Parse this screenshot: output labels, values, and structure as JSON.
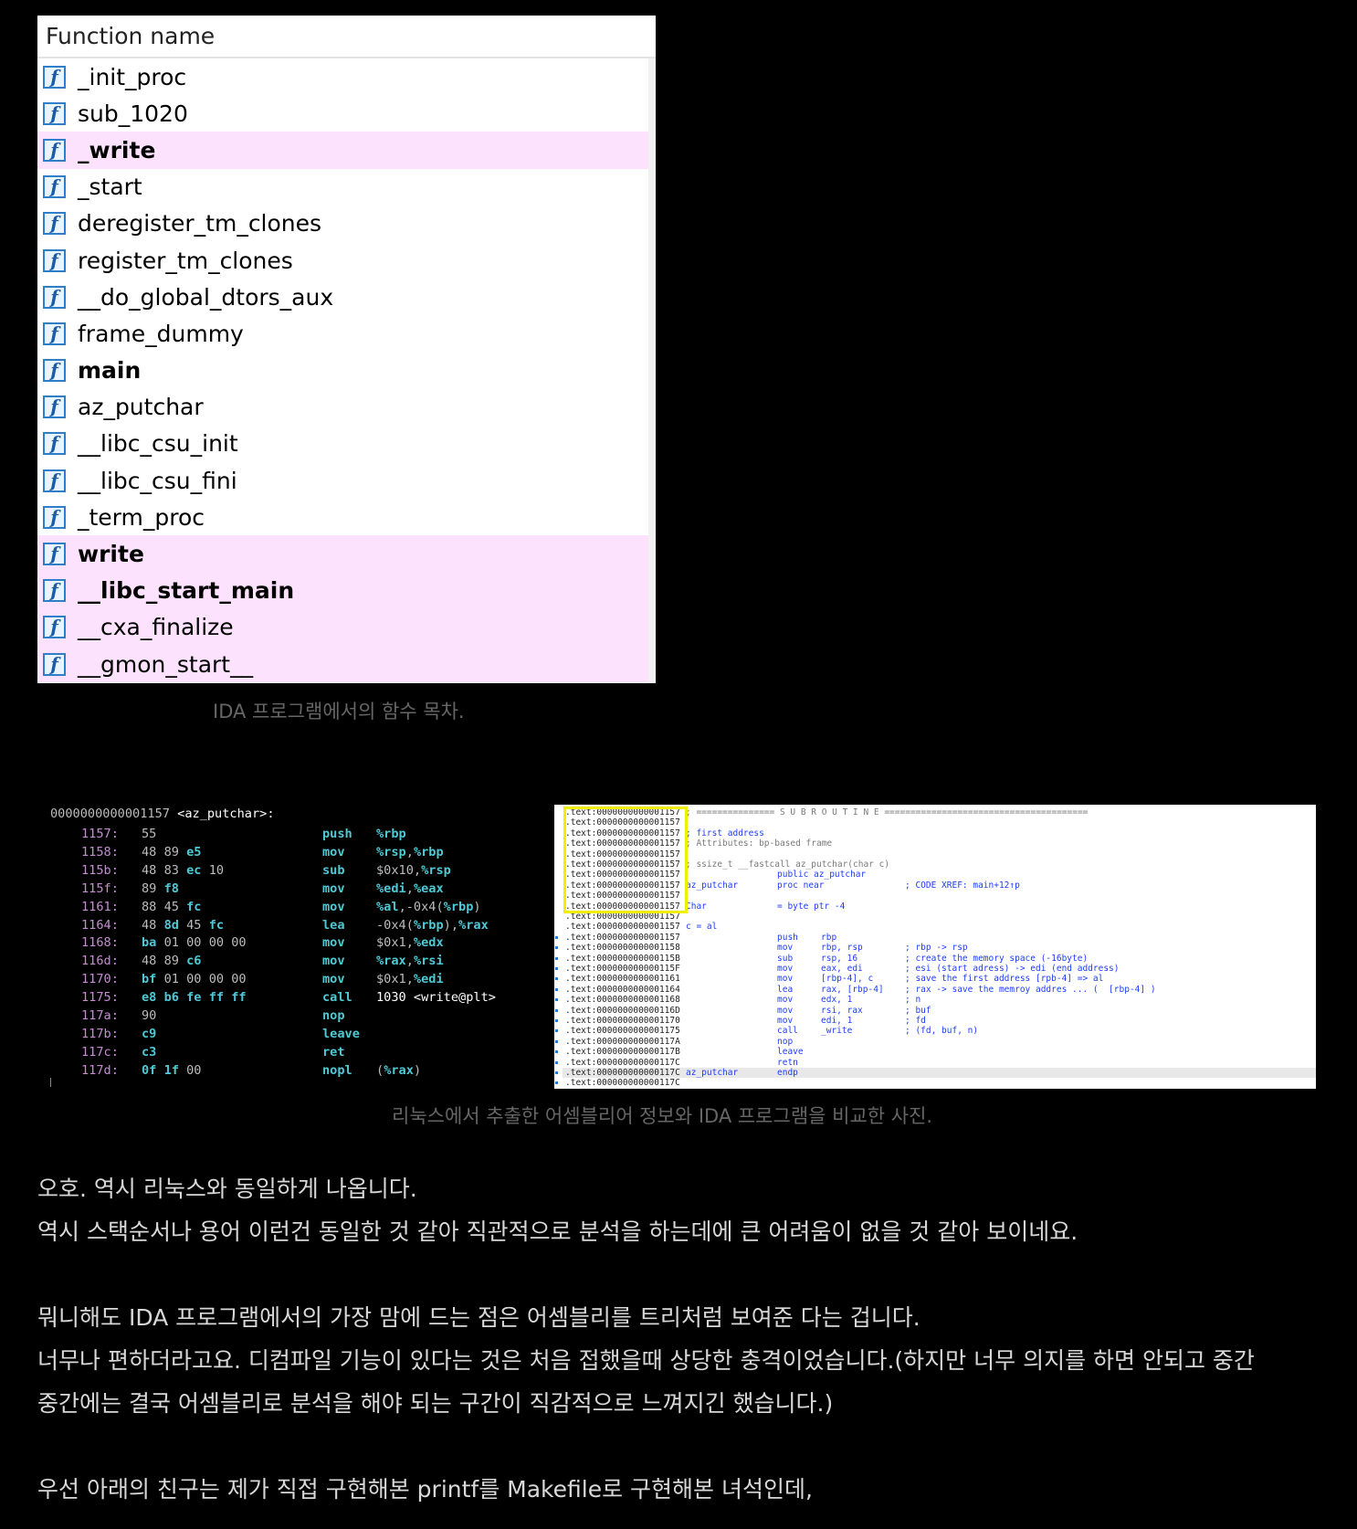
{
  "ida_functions": {
    "header": "Function name",
    "items": [
      {
        "name": "_init_proc",
        "bold": false,
        "highlight": false
      },
      {
        "name": "sub_1020",
        "bold": false,
        "highlight": false
      },
      {
        "name": "_write",
        "bold": true,
        "highlight": true
      },
      {
        "name": "_start",
        "bold": false,
        "highlight": false
      },
      {
        "name": "deregister_tm_clones",
        "bold": false,
        "highlight": false
      },
      {
        "name": "register_tm_clones",
        "bold": false,
        "highlight": false
      },
      {
        "name": "__do_global_dtors_aux",
        "bold": false,
        "highlight": false
      },
      {
        "name": "frame_dummy",
        "bold": false,
        "highlight": false
      },
      {
        "name": "main",
        "bold": true,
        "highlight": false
      },
      {
        "name": "az_putchar",
        "bold": false,
        "highlight": false
      },
      {
        "name": "__libc_csu_init",
        "bold": false,
        "highlight": false
      },
      {
        "name": "__libc_csu_fini",
        "bold": false,
        "highlight": false
      },
      {
        "name": "_term_proc",
        "bold": false,
        "highlight": false
      },
      {
        "name": "write",
        "bold": true,
        "highlight": true
      },
      {
        "name": "__libc_start_main",
        "bold": true,
        "highlight": true
      },
      {
        "name": "__cxa_finalize",
        "bold": false,
        "highlight": true
      },
      {
        "name": "__gmon_start__",
        "bold": false,
        "highlight": true
      }
    ],
    "icon": "function-icon"
  },
  "captions": {
    "ida_list": "IDA 프로그램에서의 함수 목차.",
    "compare": "리눅스에서 추출한 어셈블리어 정보와 IDA 프로그램을 비교한 사진."
  },
  "objdump": {
    "header_addr": "0000000000001157",
    "header_fn": "<az_putchar>:",
    "lines": [
      {
        "addr": "1157:",
        "bytes": "55",
        "mn": "push",
        "op": "%rbp"
      },
      {
        "addr": "1158:",
        "bytes": "48 89 e5",
        "mn": "mov",
        "op": "%rsp,%rbp"
      },
      {
        "addr": "115b:",
        "bytes": "48 83 ec 10",
        "mn": "sub",
        "op": "$0x10,%rsp"
      },
      {
        "addr": "115f:",
        "bytes": "89 f8",
        "mn": "mov",
        "op": "%edi,%eax"
      },
      {
        "addr": "1161:",
        "bytes": "88 45 fc",
        "mn": "mov",
        "op": "%al,-0x4(%rbp)"
      },
      {
        "addr": "1164:",
        "bytes": "48 8d 45 fc",
        "mn": "lea",
        "op": "-0x4(%rbp),%rax"
      },
      {
        "addr": "1168:",
        "bytes": "ba 01 00 00 00",
        "mn": "mov",
        "op": "$0x1,%edx"
      },
      {
        "addr": "116d:",
        "bytes": "48 89 c6",
        "mn": "mov",
        "op": "%rax,%rsi"
      },
      {
        "addr": "1170:",
        "bytes": "bf 01 00 00 00",
        "mn": "mov",
        "op": "$0x1,%edi"
      },
      {
        "addr": "1175:",
        "bytes": "e8 b6 fe ff ff",
        "mn": "call",
        "op": "1030 <write@plt>"
      },
      {
        "addr": "117a:",
        "bytes": "90",
        "mn": "nop",
        "op": ""
      },
      {
        "addr": "117b:",
        "bytes": "c9",
        "mn": "leave",
        "op": ""
      },
      {
        "addr": "117c:",
        "bytes": "c3",
        "mn": "ret",
        "op": ""
      },
      {
        "addr": "117d:",
        "bytes": "0f 1f 00",
        "mn": "nopl",
        "op": "(%rax)"
      }
    ]
  },
  "ida_disasm": {
    "lines": [
      {
        "addr": ".text:0000000000001157",
        "cmt": "; =============== S U B R O U T I N E ======================================="
      },
      {
        "addr": ".text:0000000000001157"
      },
      {
        "addr": ".text:0000000000001157",
        "lbl": "; first address"
      },
      {
        "addr": ".text:0000000000001157",
        "cmt": "; Attributes: bp-based frame"
      },
      {
        "addr": ".text:0000000000001157"
      },
      {
        "addr": ".text:0000000000001157",
        "cmt": "; ssize_t __fastcall az_putchar(char c)"
      },
      {
        "addr": ".text:0000000000001157",
        "mn": "public az_putchar"
      },
      {
        "addr": ".text:0000000000001157",
        "lbl": "az_putchar",
        "mn": "proc near",
        "cm": "; CODE XREF: main+12↑p"
      },
      {
        "addr": ".text:0000000000001157"
      },
      {
        "addr": ".text:0000000000001157",
        "lbl": "Char",
        "mn": "= byte ptr -4"
      },
      {
        "addr": ".text:0000000000001157"
      },
      {
        "addr": ".text:0000000000001157",
        "lbl": "c = al"
      },
      {
        "addr": ".text:0000000000001157",
        "mn": "push",
        "op": "rbp"
      },
      {
        "addr": ".text:0000000000001158",
        "mn": "mov",
        "op": "rbp, rsp",
        "cm": "; rbp -> rsp"
      },
      {
        "addr": ".text:000000000000115B",
        "mn": "sub",
        "op": "rsp, 16",
        "cm": "; create the memory space (-16byte)"
      },
      {
        "addr": ".text:000000000000115F",
        "mn": "mov",
        "op": "eax, edi",
        "cm": "; esi (start adress) -> edi (end address)"
      },
      {
        "addr": ".text:0000000000001161",
        "mn": "mov",
        "op": "[rbp-4], c",
        "cm": "; save the first address [rpb-4] => al"
      },
      {
        "addr": ".text:0000000000001164",
        "mn": "lea",
        "op": "rax, [rbp-4]",
        "cm": "; rax -> save the memroy addres ... (  [rbp-4] )"
      },
      {
        "addr": ".text:0000000000001168",
        "mn": "mov",
        "op": "edx, 1",
        "cm": "; n"
      },
      {
        "addr": ".text:000000000000116D",
        "mn": "mov",
        "op": "rsi, rax",
        "cm": "; buf"
      },
      {
        "addr": ".text:0000000000001170",
        "mn": "mov",
        "op": "edi, 1",
        "cm": "; fd"
      },
      {
        "addr": ".text:0000000000001175",
        "mn": "call",
        "op": "_write",
        "cm": "; (fd, buf, n)"
      },
      {
        "addr": ".text:000000000000117A",
        "mn": "nop"
      },
      {
        "addr": ".text:000000000000117B",
        "mn": "leave"
      },
      {
        "addr": ".text:000000000000117C",
        "mn": "retn"
      },
      {
        "addr": ".text:000000000000117C",
        "lbl": "az_putchar",
        "mn": "endp",
        "current": true
      },
      {
        "addr": ".text:000000000000117C"
      }
    ]
  },
  "body": {
    "p1": "오호. 역시 리눅스와 동일하게 나옵니다.",
    "p2": "역시 스택순서나 용어 이런건 동일한 것 같아 직관적으로 분석을 하는데에 큰 어려움이 없을 것 같아 보이네요.",
    "p3": "뭐니해도 IDA 프로그램에서의 가장 맘에 드는 점은 어셈블리를 트리처럼 보여준 다는 겁니다.",
    "p4": "너무나 편하더라고요. 디컴파일 기능이 있다는 것은 처음 접했을때 상당한 충격이었습니다.(하지만 너무 의지를 하면 안되고 중간",
    "p5": "중간에는 결국 어셈블리로 분석을 해야 되는 구간이 직감적으로 느껴지긴 했습니다.)",
    "p6": "우선 아래의 친구는 제가 직접 구현해본 printf를 Makefile로 구현해본 녀석인데,"
  }
}
